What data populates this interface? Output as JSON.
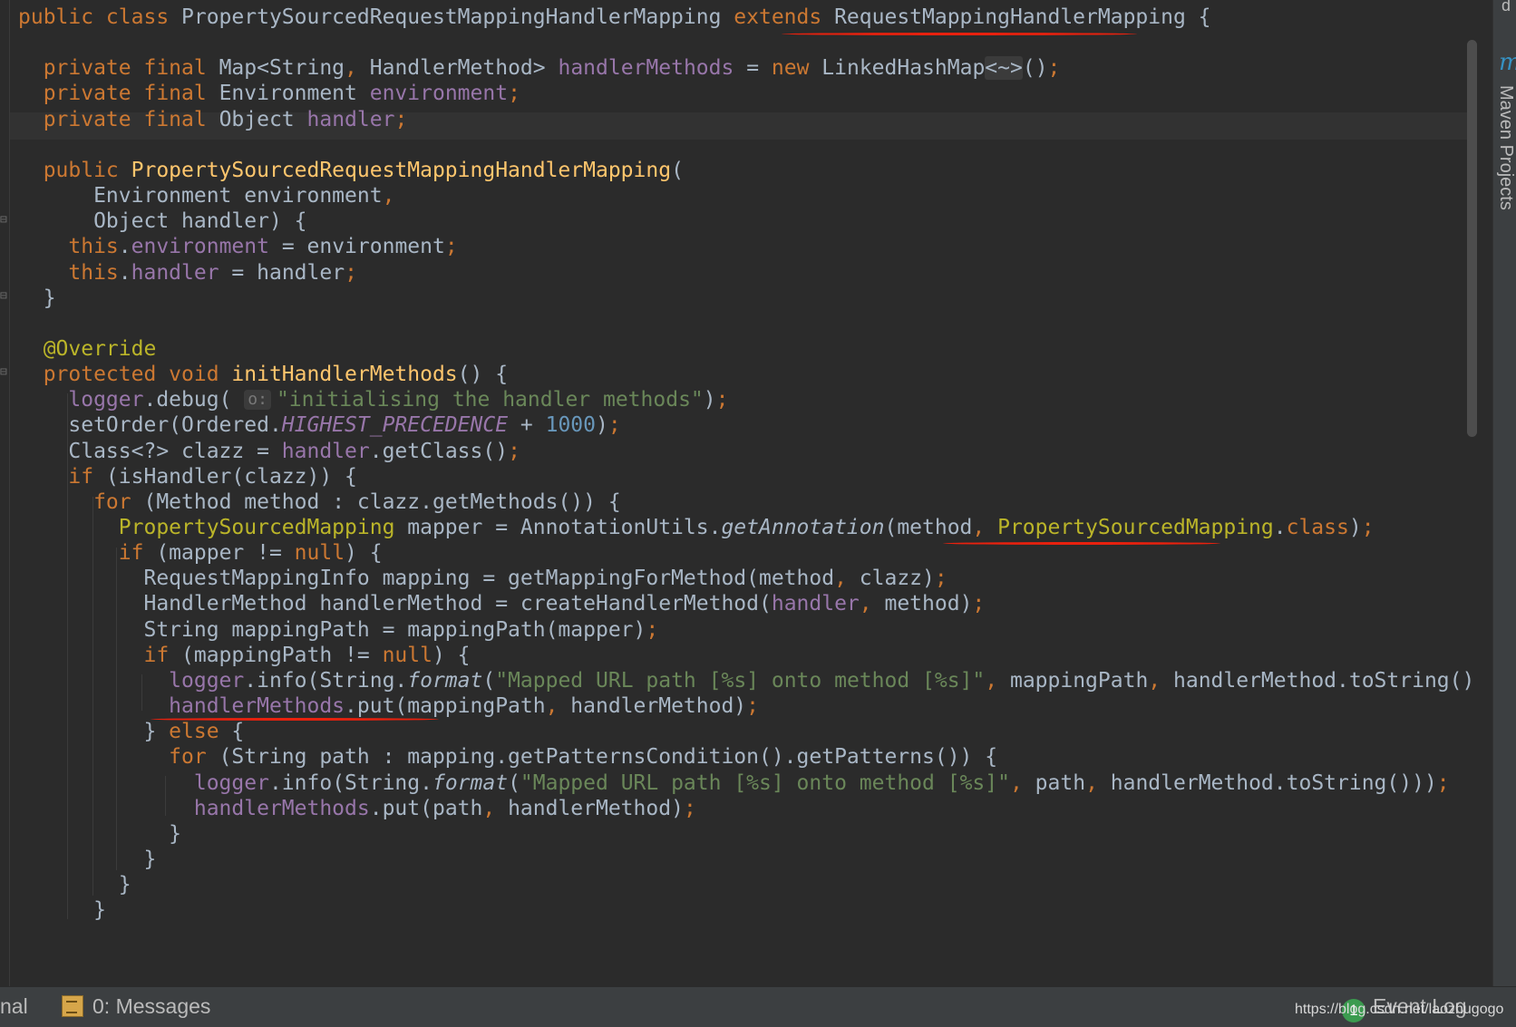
{
  "editor": {
    "lines": [
      [
        [
          "kw",
          "public class "
        ],
        [
          "plain",
          "PropertySourcedRequestMappingHandlerMapping "
        ],
        [
          "kw",
          "extends "
        ],
        [
          "plain",
          "RequestMappingHandlerMapping {"
        ]
      ],
      [],
      [
        [
          "kw",
          "  private final "
        ],
        [
          "plain",
          "Map<String"
        ],
        [
          "kw",
          ", "
        ],
        [
          "plain",
          "HandlerMethod> "
        ],
        [
          "fld",
          "handlerMethods"
        ],
        [
          "plain",
          " = "
        ],
        [
          "kw",
          "new "
        ],
        [
          "plain",
          "LinkedHashMap"
        ],
        [
          "diam",
          "<~>"
        ],
        [
          "plain",
          "()"
        ],
        [
          "kw",
          ";"
        ]
      ],
      [
        [
          "kw",
          "  private final "
        ],
        [
          "plain",
          "Environment "
        ],
        [
          "fld",
          "environment"
        ],
        [
          "kw",
          ";"
        ]
      ],
      [
        [
          "kw",
          "  private final "
        ],
        [
          "plain",
          "Object "
        ],
        [
          "fld",
          "handler"
        ],
        [
          "kw",
          ";"
        ]
      ],
      [],
      [
        [
          "kw",
          "  public "
        ],
        [
          "fn",
          "PropertySourcedRequestMappingHandlerMapping"
        ],
        [
          "plain",
          "("
        ]
      ],
      [
        [
          "plain",
          "      Environment environment"
        ],
        [
          "kw",
          ","
        ]
      ],
      [
        [
          "plain",
          "      Object handler) {"
        ]
      ],
      [
        [
          "kw",
          "    this"
        ],
        [
          "plain",
          "."
        ],
        [
          "fld",
          "environment"
        ],
        [
          "plain",
          " = environment"
        ],
        [
          "kw",
          ";"
        ]
      ],
      [
        [
          "kw",
          "    this"
        ],
        [
          "plain",
          "."
        ],
        [
          "fld",
          "handler"
        ],
        [
          "plain",
          " = handler"
        ],
        [
          "kw",
          ";"
        ]
      ],
      [
        [
          "plain",
          "  }"
        ]
      ],
      [],
      [
        [
          "ann",
          "  @Override"
        ]
      ],
      [
        [
          "kw",
          "  protected void "
        ],
        [
          "fn",
          "initHandlerMethods"
        ],
        [
          "plain",
          "() {"
        ]
      ],
      [
        [
          "fld",
          "    logger"
        ],
        [
          "plain",
          ".debug( "
        ],
        [
          "hint",
          "o:"
        ],
        [
          "str",
          "\"initialising the handler methods\""
        ],
        [
          "plain",
          ")"
        ],
        [
          "kw",
          ";"
        ]
      ],
      [
        [
          "plain",
          "    setOrder(Ordered."
        ],
        [
          "itf",
          "HIGHEST_PRECEDENCE"
        ],
        [
          "plain",
          " + "
        ],
        [
          "num",
          "1000"
        ],
        [
          "plain",
          ")"
        ],
        [
          "kw",
          ";"
        ]
      ],
      [
        [
          "plain",
          "    Class<?> clazz = "
        ],
        [
          "fld",
          "handler"
        ],
        [
          "plain",
          ".getClass()"
        ],
        [
          "kw",
          ";"
        ]
      ],
      [
        [
          "kw",
          "    if "
        ],
        [
          "plain",
          "(isHandler(clazz)) {"
        ]
      ],
      [
        [
          "kw",
          "      for "
        ],
        [
          "plain",
          "(Method method : clazz.getMethods()) {"
        ]
      ],
      [
        [
          "ann",
          "        PropertySourcedMapping "
        ],
        [
          "plain",
          "mapper = AnnotationUtils."
        ],
        [
          "it",
          "getAnnotation"
        ],
        [
          "plain",
          "(method"
        ],
        [
          "kw",
          ", "
        ],
        [
          "ann",
          "PropertySourcedMapping"
        ],
        [
          "plain",
          "."
        ],
        [
          "kw",
          "class"
        ],
        [
          "plain",
          ")"
        ],
        [
          "kw",
          ";"
        ]
      ],
      [
        [
          "kw",
          "        if "
        ],
        [
          "plain",
          "(mapper != "
        ],
        [
          "kw",
          "null"
        ],
        [
          "plain",
          ") {"
        ]
      ],
      [
        [
          "plain",
          "          RequestMappingInfo mapping = getMappingForMethod(method"
        ],
        [
          "kw",
          ", "
        ],
        [
          "plain",
          "clazz)"
        ],
        [
          "kw",
          ";"
        ]
      ],
      [
        [
          "plain",
          "          HandlerMethod handlerMethod = createHandlerMethod("
        ],
        [
          "fld",
          "handler"
        ],
        [
          "kw",
          ", "
        ],
        [
          "plain",
          "method)"
        ],
        [
          "kw",
          ";"
        ]
      ],
      [
        [
          "plain",
          "          String mappingPath = mappingPath(mapper)"
        ],
        [
          "kw",
          ";"
        ]
      ],
      [
        [
          "kw",
          "          if "
        ],
        [
          "plain",
          "(mappingPath != "
        ],
        [
          "kw",
          "null"
        ],
        [
          "plain",
          ") {"
        ]
      ],
      [
        [
          "fld",
          "            logger"
        ],
        [
          "plain",
          ".info(String."
        ],
        [
          "it",
          "format"
        ],
        [
          "plain",
          "("
        ],
        [
          "str",
          "\"Mapped URL path [%s] onto method [%s]\""
        ],
        [
          "kw",
          ", "
        ],
        [
          "plain",
          "mappingPath"
        ],
        [
          "kw",
          ", "
        ],
        [
          "plain",
          "handlerMethod.toString()"
        ]
      ],
      [
        [
          "fld",
          "            handlerMethods"
        ],
        [
          "plain",
          ".put(mappingPath"
        ],
        [
          "kw",
          ", "
        ],
        [
          "plain",
          "handlerMethod)"
        ],
        [
          "kw",
          ";"
        ]
      ],
      [
        [
          "plain",
          "          } "
        ],
        [
          "kw",
          "else "
        ],
        [
          "plain",
          "{"
        ]
      ],
      [
        [
          "kw",
          "            for "
        ],
        [
          "plain",
          "(String path : mapping.getPatternsCondition().getPatterns()) {"
        ]
      ],
      [
        [
          "fld",
          "              logger"
        ],
        [
          "plain",
          ".info(String."
        ],
        [
          "it",
          "format"
        ],
        [
          "plain",
          "("
        ],
        [
          "str",
          "\"Mapped URL path [%s] onto method [%s]\""
        ],
        [
          "kw",
          ", "
        ],
        [
          "plain",
          "path"
        ],
        [
          "kw",
          ", "
        ],
        [
          "plain",
          "handlerMethod.toString()))"
        ],
        [
          "kw",
          ";"
        ]
      ],
      [
        [
          "fld",
          "              handlerMethods"
        ],
        [
          "plain",
          ".put(path"
        ],
        [
          "kw",
          ", "
        ],
        [
          "plain",
          "handlerMethod)"
        ],
        [
          "kw",
          ";"
        ]
      ],
      [
        [
          "plain",
          "            }"
        ]
      ],
      [
        [
          "plain",
          "          }"
        ]
      ],
      [
        [
          "plain",
          "        }"
        ]
      ],
      [
        [
          "plain",
          "      }"
        ]
      ]
    ]
  },
  "right_panel": {
    "top_letter": "d",
    "maven_icon": "m",
    "maven_label": "Maven Projects"
  },
  "status_bar": {
    "terminal_label": "nal",
    "messages_label": "0: Messages",
    "event_badge": "1",
    "event_log_label": "Event Log",
    "watermark": "https://blog.csdn.net/laozhugogo"
  },
  "icons": {
    "messages": "messages-icon",
    "event_log": "event-log-icon",
    "maven": "maven-icon"
  },
  "annotations": {
    "underline_color": "#e8210e"
  }
}
